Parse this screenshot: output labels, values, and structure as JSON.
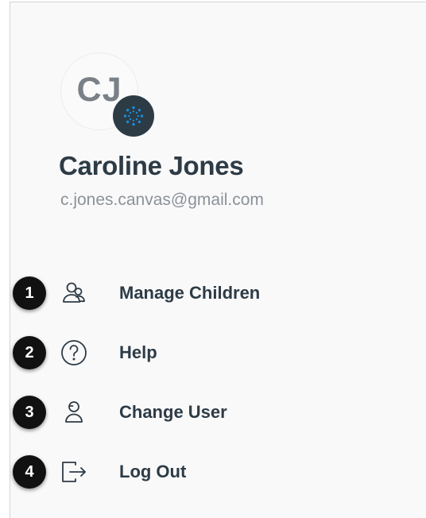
{
  "profile": {
    "initials": "CJ",
    "name": "Caroline Jones",
    "email": "c.jones.canvas@gmail.com"
  },
  "menu": {
    "items": [
      {
        "step": "1",
        "label": "Manage Children",
        "icon": "manage-children-icon"
      },
      {
        "step": "2",
        "label": "Help",
        "icon": "help-icon"
      },
      {
        "step": "3",
        "label": "Change User",
        "icon": "change-user-icon"
      },
      {
        "step": "4",
        "label": "Log Out",
        "icon": "log-out-icon"
      }
    ]
  },
  "colors": {
    "text_dark": "#2d3b45",
    "text_muted": "#8b9298",
    "badge_bg": "#2d3b45",
    "badge_accent": "#1a8cd8",
    "step_bg": "#111111"
  }
}
